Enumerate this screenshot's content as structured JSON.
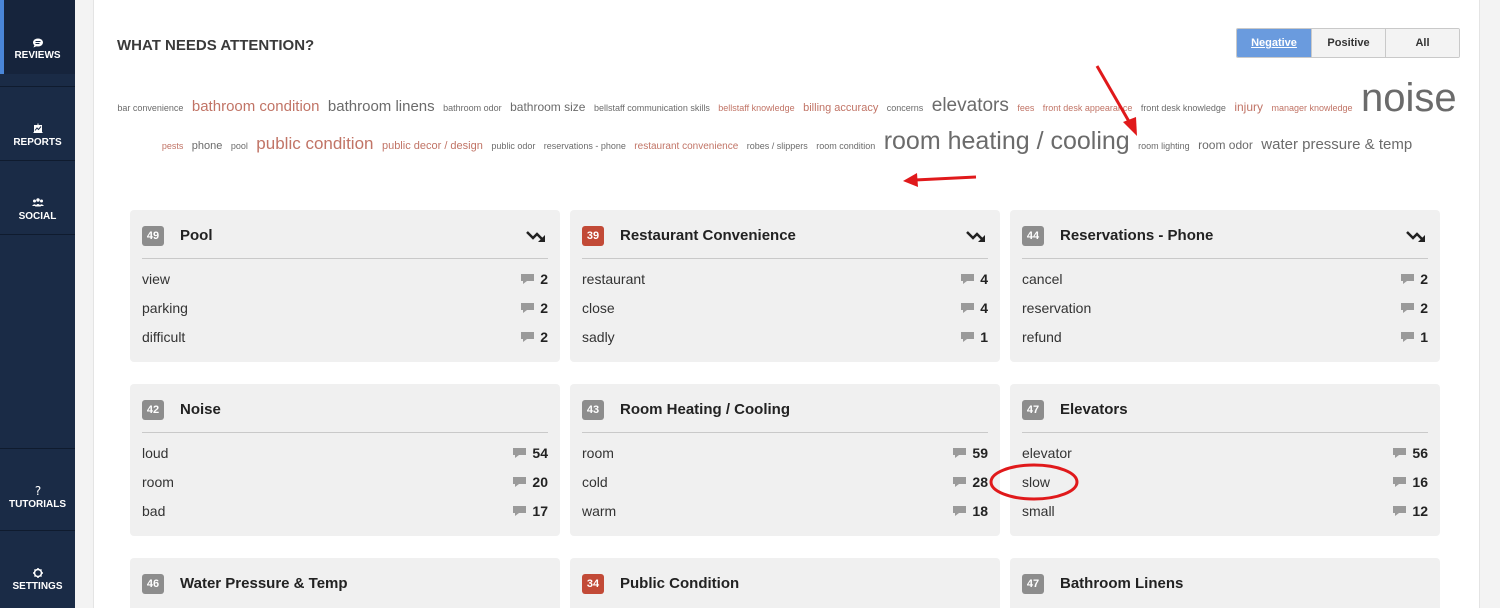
{
  "sidebar": {
    "items": [
      {
        "label": "REVIEWS",
        "icon": "reviews-chat-icon"
      },
      {
        "label": "REPORTS",
        "icon": "reports-chart-icon"
      },
      {
        "label": "SOCIAL",
        "icon": "social-people-icon"
      },
      {
        "label": "TUTORIALS",
        "icon": "question-icon"
      },
      {
        "label": "SETTINGS",
        "icon": "gear-icon"
      }
    ]
  },
  "header": {
    "title": "WHAT NEEDS ATTENTION?",
    "filters": [
      "Negative",
      "Positive",
      "All"
    ],
    "active_filter": "Negative"
  },
  "cloud": [
    {
      "text": "bar convenience",
      "tone": "gray",
      "size": 9
    },
    {
      "text": "bathroom condition",
      "tone": "red",
      "size": 15
    },
    {
      "text": "bathroom linens",
      "tone": "gray",
      "size": 15
    },
    {
      "text": "bathroom odor",
      "tone": "gray",
      "size": 9
    },
    {
      "text": "bathroom size",
      "tone": "gray",
      "size": 12
    },
    {
      "text": "bellstaff communication skills",
      "tone": "gray",
      "size": 9
    },
    {
      "text": "bellstaff knowledge",
      "tone": "red",
      "size": 9
    },
    {
      "text": "billing accuracy",
      "tone": "red",
      "size": 11
    },
    {
      "text": "concerns",
      "tone": "gray",
      "size": 9
    },
    {
      "text": "elevators",
      "tone": "gray",
      "size": 19
    },
    {
      "text": "fees",
      "tone": "red",
      "size": 9
    },
    {
      "text": "front desk appearance",
      "tone": "red",
      "size": 9
    },
    {
      "text": "front desk knowledge",
      "tone": "gray",
      "size": 9
    },
    {
      "text": "injury",
      "tone": "red",
      "size": 12
    },
    {
      "text": "manager knowledge",
      "tone": "red",
      "size": 9
    },
    {
      "text": "noise",
      "tone": "gray",
      "size": 40
    },
    {
      "text": "pests",
      "tone": "red",
      "size": 9
    },
    {
      "text": "phone",
      "tone": "gray",
      "size": 11
    },
    {
      "text": "pool",
      "tone": "gray",
      "size": 9
    },
    {
      "text": "public condition",
      "tone": "red",
      "size": 17
    },
    {
      "text": "public decor / design",
      "tone": "red",
      "size": 11
    },
    {
      "text": "public odor",
      "tone": "gray",
      "size": 9
    },
    {
      "text": "reservations - phone",
      "tone": "gray",
      "size": 9
    },
    {
      "text": "restaurant convenience",
      "tone": "red",
      "size": 10
    },
    {
      "text": "robes / slippers",
      "tone": "gray",
      "size": 9
    },
    {
      "text": "room condition",
      "tone": "gray",
      "size": 9
    },
    {
      "text": "room heating / cooling",
      "tone": "gray",
      "size": 25
    },
    {
      "text": "room lighting",
      "tone": "gray",
      "size": 9
    },
    {
      "text": "room odor",
      "tone": "gray",
      "size": 12
    },
    {
      "text": "water pressure & temp",
      "tone": "gray",
      "size": 15
    }
  ],
  "cards": [
    {
      "score": "49",
      "badge": "gray",
      "title": "Pool",
      "trend": true,
      "rows": [
        {
          "word": "view",
          "count": "2"
        },
        {
          "word": "parking",
          "count": "2"
        },
        {
          "word": "difficult",
          "count": "2"
        }
      ]
    },
    {
      "score": "39",
      "badge": "red",
      "title": "Restaurant Convenience",
      "trend": true,
      "rows": [
        {
          "word": "restaurant",
          "count": "4"
        },
        {
          "word": "close",
          "count": "4"
        },
        {
          "word": "sadly",
          "count": "1"
        }
      ]
    },
    {
      "score": "44",
      "badge": "gray",
      "title": "Reservations - Phone",
      "trend": true,
      "rows": [
        {
          "word": "cancel",
          "count": "2"
        },
        {
          "word": "reservation",
          "count": "2"
        },
        {
          "word": "refund",
          "count": "1"
        }
      ]
    },
    {
      "score": "42",
      "badge": "gray",
      "title": "Noise",
      "trend": false,
      "rows": [
        {
          "word": "loud",
          "count": "54"
        },
        {
          "word": "room",
          "count": "20"
        },
        {
          "word": "bad",
          "count": "17"
        }
      ]
    },
    {
      "score": "43",
      "badge": "gray",
      "title": "Room Heating / Cooling",
      "trend": false,
      "rows": [
        {
          "word": "room",
          "count": "59"
        },
        {
          "word": "cold",
          "count": "28"
        },
        {
          "word": "warm",
          "count": "18"
        }
      ]
    },
    {
      "score": "47",
      "badge": "gray",
      "title": "Elevators",
      "trend": false,
      "rows": [
        {
          "word": "elevator",
          "count": "56"
        },
        {
          "word": "slow",
          "count": "16"
        },
        {
          "word": "small",
          "count": "12"
        }
      ]
    },
    {
      "score": "46",
      "badge": "gray",
      "title": "Water Pressure & Temp",
      "trend": false,
      "rows": []
    },
    {
      "score": "34",
      "badge": "red",
      "title": "Public Condition",
      "trend": false,
      "rows": []
    },
    {
      "score": "47",
      "badge": "gray",
      "title": "Bathroom Linens",
      "trend": false,
      "rows": []
    }
  ],
  "colors": {
    "sidebar": "#1a2b46",
    "accent": "#6a9bde",
    "badge_red": "#c24a37",
    "badge_gray": "#8d8d8d",
    "cloud_red": "#c17466",
    "annotation": "#e0191b"
  }
}
